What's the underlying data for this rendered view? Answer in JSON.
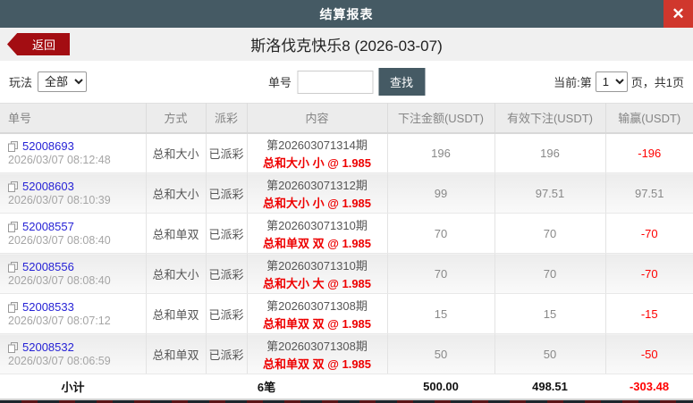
{
  "header": {
    "title": "结算报表",
    "close_label": "✕"
  },
  "subheader": {
    "back_label": "返回",
    "title": "斯洛伐克快乐8 (2026-03-07)"
  },
  "filters": {
    "play_label": "玩法",
    "play_selected": "全部",
    "order_label": "单号",
    "order_value": "",
    "search_label": "查找",
    "page_prefix": "当前:第",
    "page_selected": "1",
    "page_suffix": "页，共1页"
  },
  "table": {
    "columns": [
      "单号",
      "方式",
      "派彩",
      "内容",
      "下注金额(USDT)",
      "有效下注(USDT)",
      "输赢(USDT)"
    ],
    "rows": [
      {
        "order_no": "52008693",
        "time": "2026/03/07 08:12:48",
        "method": "总和大小",
        "payout": "已派彩",
        "period": "第202603071314期",
        "bet": "总和大小 小 @ 1.985",
        "amount": "196",
        "valid": "196",
        "winloss": "-196"
      },
      {
        "order_no": "52008603",
        "time": "2026/03/07 08:10:39",
        "method": "总和大小",
        "payout": "已派彩",
        "period": "第202603071312期",
        "bet": "总和大小 小 @ 1.985",
        "amount": "99",
        "valid": "97.51",
        "winloss": "97.51"
      },
      {
        "order_no": "52008557",
        "time": "2026/03/07 08:08:40",
        "method": "总和单双",
        "payout": "已派彩",
        "period": "第202603071310期",
        "bet": "总和单双 双 @ 1.985",
        "amount": "70",
        "valid": "70",
        "winloss": "-70"
      },
      {
        "order_no": "52008556",
        "time": "2026/03/07 08:08:40",
        "method": "总和大小",
        "payout": "已派彩",
        "period": "第202603071310期",
        "bet": "总和大小 大 @ 1.985",
        "amount": "70",
        "valid": "70",
        "winloss": "-70"
      },
      {
        "order_no": "52008533",
        "time": "2026/03/07 08:07:12",
        "method": "总和单双",
        "payout": "已派彩",
        "period": "第202603071308期",
        "bet": "总和单双 双 @ 1.985",
        "amount": "15",
        "valid": "15",
        "winloss": "-15"
      },
      {
        "order_no": "52008532",
        "time": "2026/03/07 08:06:59",
        "method": "总和单双",
        "payout": "已派彩",
        "period": "第202603071308期",
        "bet": "总和单双 双 @ 1.985",
        "amount": "50",
        "valid": "50",
        "winloss": "-50"
      }
    ],
    "summary": {
      "label": "小计",
      "count": "6笔",
      "amount": "500.00",
      "valid": "498.51",
      "winloss": "-303.48"
    }
  },
  "colors": {
    "accent_dark": "#455a64",
    "close_red": "#d0372d",
    "back_red": "#a30d12",
    "bet_red": "#ee0000",
    "link_blue": "#2622d6"
  }
}
